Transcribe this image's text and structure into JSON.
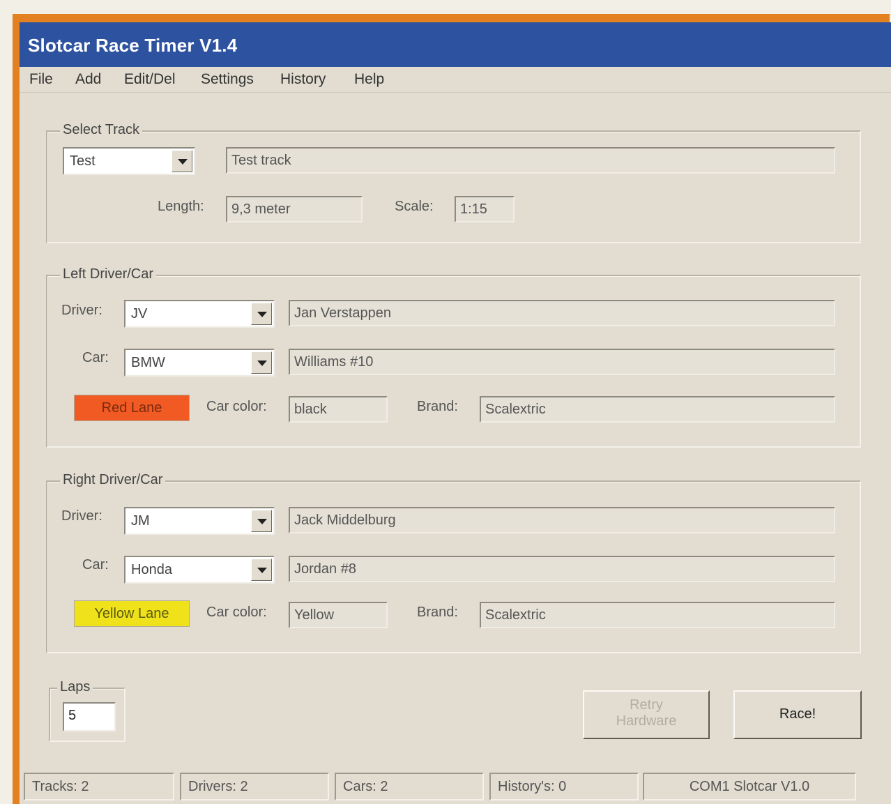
{
  "window": {
    "title": "Slotcar Race Timer V1.4"
  },
  "menu": [
    "File",
    "Add",
    "Edit/Del",
    "Settings",
    "History",
    "Help"
  ],
  "track": {
    "legend": "Select Track",
    "selected": "Test",
    "description": "Test track",
    "length_label": "Length:",
    "length_value": "9,3 meter",
    "scale_label": "Scale:",
    "scale_value": "1:15"
  },
  "left": {
    "legend": "Left Driver/Car",
    "driver_label": "Driver:",
    "driver_code": "JV",
    "driver_name": "Jan Verstappen",
    "car_label": "Car:",
    "car_model": "BMW",
    "car_description": "Williams #10",
    "lane_label": "Red Lane",
    "lane_color": "#f15a22",
    "car_color_label": "Car color:",
    "car_color_value": "black",
    "brand_label": "Brand:",
    "brand_value": "Scalextric"
  },
  "right": {
    "legend": "Right Driver/Car",
    "driver_label": "Driver:",
    "driver_code": "JM",
    "driver_name": "Jack Middelburg",
    "car_label": "Car:",
    "car_model": "Honda",
    "car_description": "Jordan #8",
    "lane_label": "Yellow Lane",
    "lane_color": "#f0e21a",
    "car_color_label": "Car color:",
    "car_color_value": "Yellow",
    "brand_label": "Brand:",
    "brand_value": "Scalextric"
  },
  "laps": {
    "legend": "Laps",
    "value": "5"
  },
  "buttons": {
    "retry_line1": "Retry",
    "retry_line2": "Hardware",
    "race": "Race!"
  },
  "status": {
    "tracks": "Tracks: 2",
    "drivers": "Drivers: 2",
    "cars": "Cars: 2",
    "history": "History's: 0",
    "port": "COM1 Slotcar V1.0"
  }
}
